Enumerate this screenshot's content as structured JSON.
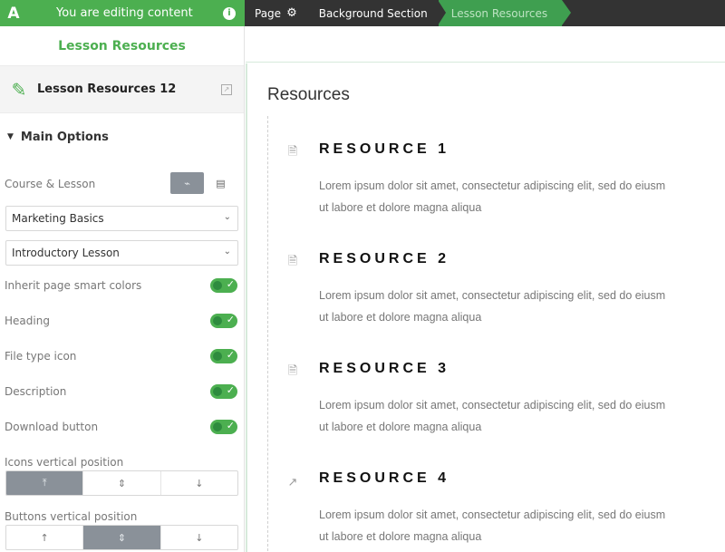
{
  "topbar": {
    "logo": "A",
    "editing_text": "You are editing content",
    "info_glyph": "i",
    "crumbs": {
      "page": "Page",
      "section": "Background Section",
      "element": "Lesson Resources"
    }
  },
  "sidebar": {
    "title": "Lesson Resources",
    "element_title": "Lesson Resources 12",
    "main_options": "Main Options",
    "course_lesson_label": "Course & Lesson",
    "course_select": "Marketing Basics",
    "lesson_select": "Introductory Lesson",
    "toggles": [
      {
        "label": "Inherit page smart colors",
        "on": true
      },
      {
        "label": "Heading",
        "on": true
      },
      {
        "label": "File type icon",
        "on": true
      },
      {
        "label": "Description",
        "on": true
      },
      {
        "label": "Download button",
        "on": true
      }
    ],
    "icons_position_label": "Icons vertical position",
    "buttons_position_label": "Buttons vertical position",
    "icons_position_selected": "top",
    "buttons_position_selected": "middle"
  },
  "main": {
    "title": "Resources",
    "resources": [
      {
        "heading": "RESOURCE 1",
        "line1": "Lorem ipsum dolor sit amet, consectetur adipiscing elit, sed do eiusm",
        "line2": "ut labore et dolore magna aliqua",
        "icon": "doc-icon"
      },
      {
        "heading": "RESOURCE 2",
        "line1": "Lorem ipsum dolor sit amet, consectetur adipiscing elit, sed do eiusm",
        "line2": "ut labore et dolore magna aliqua",
        "icon": "doc-icon"
      },
      {
        "heading": "RESOURCE 3",
        "line1": "Lorem ipsum dolor sit amet, consectetur adipiscing elit, sed do eiusm",
        "line2": "ut labore et dolore magna aliqua",
        "icon": "pdf-icon"
      },
      {
        "heading": "RESOURCE 4",
        "line1": "Lorem ipsum dolor sit amet, consectetur adipiscing elit, sed do eiusm",
        "line2": "ut labore et dolore magna aliqua",
        "icon": "external-link-icon"
      }
    ]
  },
  "colors": {
    "accent": "#4caf50",
    "topbar": "#333333",
    "segment_active": "#8a9199"
  }
}
